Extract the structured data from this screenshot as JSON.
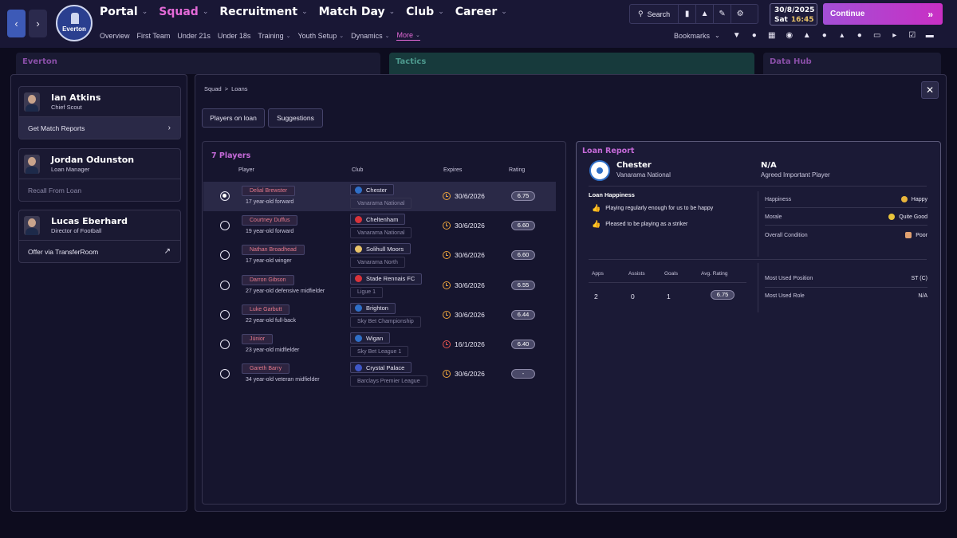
{
  "nav": {
    "main": [
      {
        "label": "Portal"
      },
      {
        "label": "Squad"
      },
      {
        "label": "Recruitment"
      },
      {
        "label": "Match Day"
      },
      {
        "label": "Club"
      },
      {
        "label": "Career"
      }
    ],
    "sub": [
      {
        "label": "Overview"
      },
      {
        "label": "First Team"
      },
      {
        "label": "Under 21s"
      },
      {
        "label": "Under 18s"
      },
      {
        "label": "Training"
      },
      {
        "label": "Youth Setup"
      },
      {
        "label": "Dynamics"
      },
      {
        "label": "More"
      }
    ],
    "crest_label": "Everton",
    "search_label": "Search",
    "date": "30/8/2025",
    "weekday": "Sat",
    "time": "16:45",
    "continue_label": "Continue",
    "bookmarks_label": "Bookmarks"
  },
  "background_panels": {
    "everton": "Everton",
    "tactics": "Tactics",
    "datahub": "Data Hub"
  },
  "staff": [
    {
      "name": "Ian Atkins",
      "role": "Chief Scout",
      "action": "Get Match Reports"
    },
    {
      "name": "Jordan Odunston",
      "role": "Loan Manager",
      "action": "Recall From Loan"
    },
    {
      "name": "Lucas Eberhard",
      "role": "Director of Football",
      "action": "Offer via TransferRoom"
    }
  ],
  "breadcrumb": {
    "root": "Squad",
    "sep": ">",
    "current": "Loans"
  },
  "tabs": {
    "players_on_loan": "Players on loan",
    "suggestions": "Suggestions"
  },
  "players": {
    "count_label": "7 Players",
    "columns": {
      "player": "Player",
      "club": "Club",
      "expires": "Expires",
      "rating": "Rating"
    },
    "rows": [
      {
        "name": "Delial Brewster",
        "desc": "17 year-old forward",
        "club": "Chester",
        "league": "Vanarama National",
        "expires": "30/6/2026",
        "rating": "6.75",
        "club_color": "#2f6fc7",
        "exp_color": "#e9a13b"
      },
      {
        "name": "Courtney Duffus",
        "desc": "19 year-old forward",
        "club": "Cheltenham",
        "league": "Vanarama National",
        "expires": "30/6/2026",
        "rating": "6.60",
        "club_color": "#d8333b",
        "exp_color": "#e9a13b"
      },
      {
        "name": "Nathan Broadhead",
        "desc": "17 year-old winger",
        "club": "Solihull Moors",
        "league": "Vanarama North",
        "expires": "30/6/2026",
        "rating": "6.60",
        "club_color": "#e9c46a",
        "exp_color": "#e9a13b"
      },
      {
        "name": "Darron Gibson",
        "desc": "27 year-old defensive midfielder",
        "club": "Stade Rennais FC",
        "league": "Ligue 1",
        "expires": "30/6/2026",
        "rating": "6.55",
        "club_color": "#d8333b",
        "exp_color": "#e9a13b"
      },
      {
        "name": "Luke Garbutt",
        "desc": "22 year-old full-back",
        "club": "Brighton",
        "league": "Sky Bet Championship",
        "expires": "30/6/2026",
        "rating": "6.44",
        "club_color": "#2f6fc7",
        "exp_color": "#e9a13b"
      },
      {
        "name": "Júnior",
        "desc": "23 year-old midfielder",
        "club": "Wigan",
        "league": "Sky Bet League 1",
        "expires": "16/1/2026",
        "rating": "6.40",
        "club_color": "#2f6fc7",
        "exp_color": "#e2524d"
      },
      {
        "name": "Gareth Barry",
        "desc": "34 year-old veteran midfielder",
        "club": "Crystal Palace",
        "league": "Barclays Premier League",
        "expires": "30/6/2026",
        "rating": "-",
        "club_color": "#3f57c7",
        "exp_color": "#e9a13b"
      }
    ]
  },
  "report": {
    "title": "Loan Report",
    "club": "Chester",
    "league": "Vanarama National",
    "fee": "N/A",
    "status": "Agreed Important Player",
    "happiness_title": "Loan Happiness",
    "happiness_items": [
      "Playing regularly enough for us to be happy",
      "Pleased to be playing as a striker"
    ],
    "stats": [
      {
        "label": "Happiness",
        "value": "Happy",
        "dot": "#e9b53b"
      },
      {
        "label": "Morale",
        "value": "Quite Good",
        "dot": "#e9c43b"
      },
      {
        "label": "Overall Condition",
        "value": "Poor",
        "dot": "#e0a070"
      }
    ],
    "apps_headers": {
      "apps": "Apps",
      "assists": "Assists",
      "goals": "Goals",
      "avg_rating": "Avg. Rating"
    },
    "apps_values": {
      "apps": "2",
      "assists": "0",
      "goals": "1",
      "avg_rating": "6.75"
    },
    "position": {
      "label": "Most Used Position",
      "value": "ST (C)"
    },
    "role": {
      "label": "Most Used Role",
      "value": "N/A"
    }
  }
}
